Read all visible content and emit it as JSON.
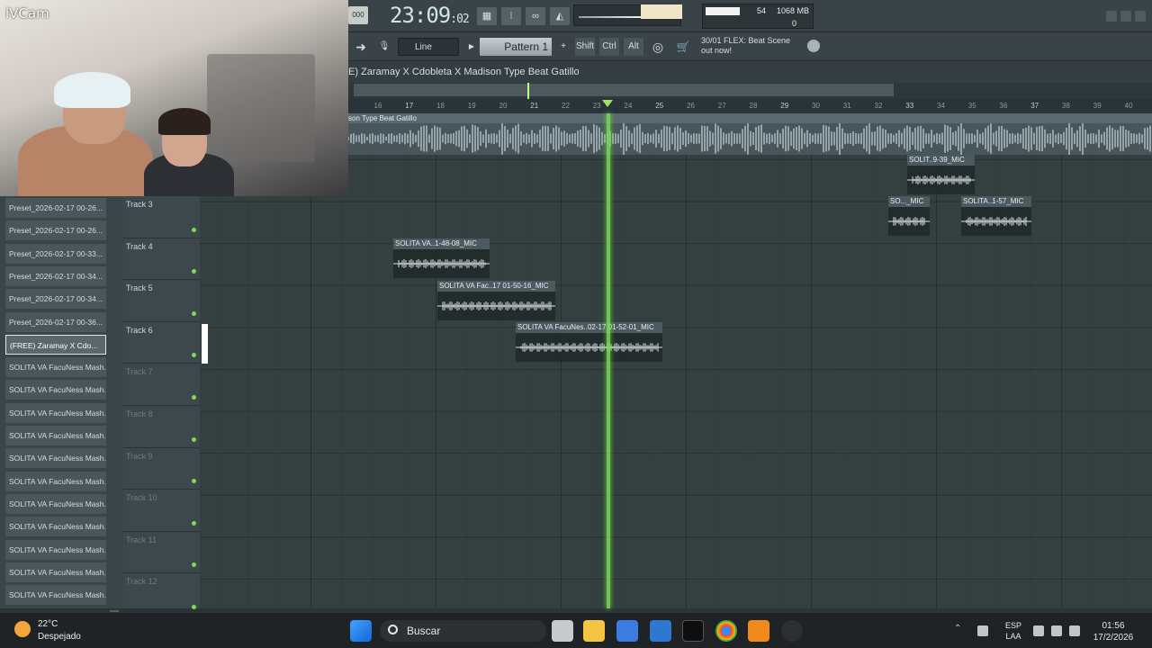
{
  "webcam": {
    "title": "iVCam"
  },
  "toolbar": {
    "tempo": "000",
    "time_main": "23:09",
    "time_sub": ":02",
    "cpu_value": "54",
    "memory": "1068 MB",
    "polyphony": "0"
  },
  "toolbar2": {
    "snap": "Line",
    "pattern": "Pattern 1",
    "keys": [
      "Shift",
      "Ctrl",
      "Alt"
    ],
    "hint_line1": "30/01  FLEX: Beat Scene",
    "hint_line2": "out now!"
  },
  "playlist": {
    "title": "E) Zaramay X Cdobleta X Madison Type Beat Gatillo",
    "ruler": [
      "16",
      "17",
      "18",
      "19",
      "20",
      "21",
      "22",
      "23",
      "24",
      "25",
      "26",
      "27",
      "28",
      "29",
      "30",
      "31",
      "32",
      "33",
      "34",
      "35",
      "36",
      "37",
      "38",
      "39",
      "40"
    ],
    "audio_track_label": "son Type Beat Gatillo",
    "tracks": [
      "Track 3",
      "Track 4",
      "Track 5",
      "Track 6",
      "Track 7",
      "Track 8",
      "Track 9",
      "Track 10",
      "Track 11",
      "Track 12"
    ],
    "clips": [
      {
        "name": "SOLIT..9-39_MIC"
      },
      {
        "name": "SO..._MIC"
      },
      {
        "name": "SOLITA..1-57_MIC"
      },
      {
        "name": "SOLITA VA..1-48-08_MIC"
      },
      {
        "name": "SOLITA VA Fac..17 01-50-16_MIC"
      },
      {
        "name": "SOLITA VA FacuNes..02-17 01-52-01_MIC"
      }
    ]
  },
  "browser": {
    "items": [
      "Preset_2026-02-17 00-26...",
      "Preset_2026-02-17 00-26...",
      "Preset_2026-02-17 00-33...",
      "Preset_2026-02-17 00-34...",
      "Preset_2026-02-17 00-34...",
      "Preset_2026-02-17 00-36...",
      "(FREE) Zaramay X Cdo...",
      "SOLITA VA FacuNess Mash...",
      "SOLITA VA FacuNess Mash...",
      "SOLITA VA FacuNess Mash...",
      "SOLITA VA FacuNess Mash...",
      "SOLITA VA FacuNess Mash...",
      "SOLITA VA FacuNess Mash...",
      "SOLITA VA FacuNess Mash...",
      "SOLITA VA FacuNess Mash...",
      "SOLITA VA FacuNess Mash...",
      "SOLITA VA FacuNess Mash...",
      "SOLITA VA FacuNess Mash..."
    ],
    "selected_index": 6
  },
  "taskbar": {
    "temperature": "22°C",
    "condition": "Despejado",
    "search_placeholder": "Buscar",
    "lang1": "ESP",
    "lang2": "LAA",
    "time": "01:56",
    "date": "17/2/2026"
  },
  "colors": {
    "playhead": "#7ed957",
    "accent": "#9ee65b"
  }
}
